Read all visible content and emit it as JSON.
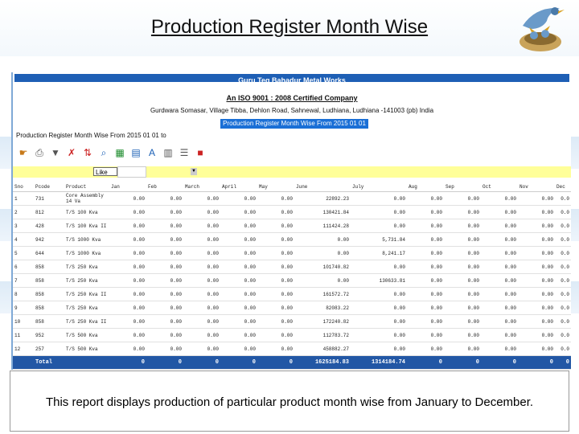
{
  "slide": {
    "title": "Production Register Month Wise",
    "description": "This report displays production of particular product month wise from January to December."
  },
  "report": {
    "company": "Guru Teg Bahadur Metal Works",
    "iso": "An ISO 9001 : 2008 Certified Company",
    "address": "Gurdwara Somasar, Village Tibba, Dehlon Road, Sahnewal, Ludhiana, Ludhiana -141003 (pb) India",
    "title_highlight": "Production Register Month Wise From 2015 01 01 to",
    "subtitle": "Production Register Month Wise From 2015 01 01 to"
  },
  "toolbar": {
    "icons": [
      "pointer-icon",
      "print-icon",
      "filter-icon",
      "clear-filter-icon",
      "sort-icon",
      "find-icon",
      "chart-icon",
      "grid-icon",
      "font-icon",
      "export-icon",
      "list-icon",
      "pdf-icon"
    ]
  },
  "filter": {
    "like_label": "Like"
  },
  "table": {
    "columns": [
      "Sno",
      "Pcode",
      "Product",
      "Jan",
      "Feb",
      "March",
      "April",
      "May",
      "June",
      "July",
      "Aug",
      "Sep",
      "Oct",
      "Nov",
      "Dec"
    ],
    "rows": [
      [
        "1",
        "731",
        "Core Assembly 14 Va",
        "0.00",
        "0.00",
        "0.00",
        "0.00",
        "0.00",
        "22892.23",
        "0.00",
        "0.00",
        "0.00",
        "0.00",
        "0.00",
        "0.0"
      ],
      [
        "2",
        "812",
        "T/S 100 Kva",
        "0.00",
        "0.00",
        "0.00",
        "0.00",
        "0.00",
        "130421.84",
        "0.00",
        "0.00",
        "0.00",
        "0.00",
        "0.00",
        "0.0"
      ],
      [
        "3",
        "428",
        "T/S 100 Kva II",
        "0.00",
        "0.00",
        "0.00",
        "0.00",
        "0.00",
        "111424.28",
        "0.00",
        "0.00",
        "0.00",
        "0.00",
        "0.00",
        "0.0"
      ],
      [
        "4",
        "942",
        "T/S 1000 Kva",
        "0.00",
        "0.00",
        "0.00",
        "0.00",
        "0.00",
        "0.00",
        "5,731.84",
        "0.00",
        "0.00",
        "0.00",
        "0.00",
        "0.0"
      ],
      [
        "5",
        "644",
        "T/S 1000 Kva",
        "0.00",
        "0.00",
        "0.00",
        "0.00",
        "0.00",
        "0.00",
        "8,241.17",
        "0.00",
        "0.00",
        "0.00",
        "0.00",
        "0.0"
      ],
      [
        "6",
        "858",
        "T/S 250 Kva",
        "0.00",
        "0.00",
        "0.00",
        "0.00",
        "0.00",
        "101740.82",
        "0.00",
        "0.00",
        "0.00",
        "0.00",
        "0.00",
        "0.0"
      ],
      [
        "7",
        "858",
        "T/S 250 Kva",
        "0.00",
        "0.00",
        "0.00",
        "0.00",
        "0.00",
        "0.00",
        "130633.81",
        "0.00",
        "0.00",
        "0.00",
        "0.00",
        "0.0"
      ],
      [
        "8",
        "858",
        "T/S 250 Kva II",
        "0.00",
        "0.00",
        "0.00",
        "0.00",
        "0.00",
        "161572.72",
        "0.00",
        "0.00",
        "0.00",
        "0.00",
        "0.00",
        "0.0"
      ],
      [
        "9",
        "858",
        "T/S 250 Kva",
        "0.00",
        "0.00",
        "0.00",
        "0.00",
        "0.00",
        "82083.22",
        "0.00",
        "0.00",
        "0.00",
        "0.00",
        "0.00",
        "0.0"
      ],
      [
        "10",
        "858",
        "T/S 250 Kva II",
        "0.00",
        "0.00",
        "0.00",
        "0.00",
        "0.00",
        "172240.82",
        "0.00",
        "0.00",
        "0.00",
        "0.00",
        "0.00",
        "0.0"
      ],
      [
        "11",
        "952",
        "T/S 500 Kva",
        "0.00",
        "0.00",
        "0.00",
        "0.00",
        "0.00",
        "112783.72",
        "0.00",
        "0.00",
        "0.00",
        "0.00",
        "0.00",
        "0.0"
      ],
      [
        "12",
        "257",
        "T/S 500 Kva",
        "0.00",
        "0.00",
        "0.00",
        "0.00",
        "0.00",
        "458882.27",
        "0.00",
        "0.00",
        "0.00",
        "0.00",
        "0.00",
        "0.0"
      ]
    ],
    "total": [
      "",
      "Total",
      "",
      "0",
      "0",
      "0",
      "0",
      "0",
      "1625184.83",
      "1314184.74",
      "0",
      "0",
      "0",
      "0",
      "0"
    ]
  },
  "colors": {
    "header_blue": "#1e5fb5",
    "total_blue": "#2257a5",
    "filter_yellow": "#ffff99"
  }
}
